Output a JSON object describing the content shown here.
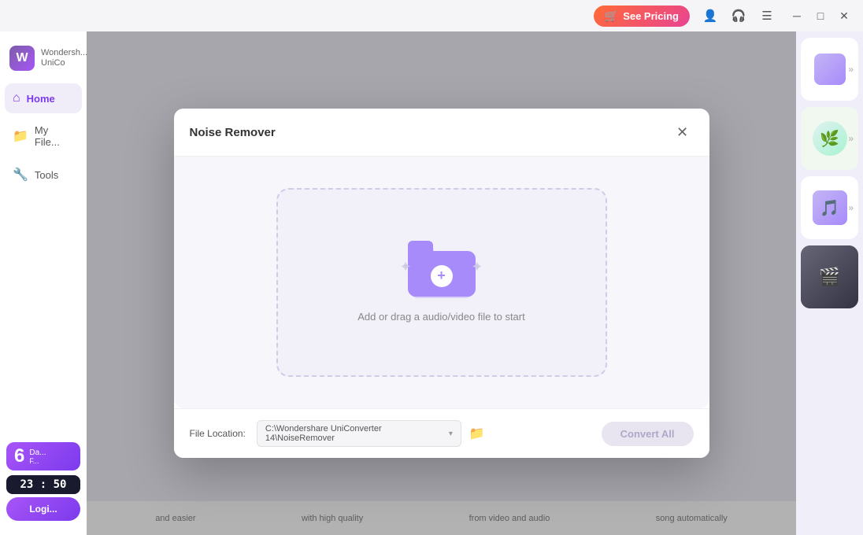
{
  "titlebar": {
    "see_pricing_label": "See Pricing",
    "cart_icon": "🛒",
    "user_icon": "👤",
    "headset_icon": "🎧",
    "menu_icon": "☰",
    "minimize_icon": "─",
    "maximize_icon": "□",
    "close_icon": "✕"
  },
  "sidebar": {
    "logo_text": "Wondersh...\nUniCo",
    "nav_items": [
      {
        "label": "Home",
        "icon": "⌂",
        "active": true
      },
      {
        "label": "My File...",
        "icon": "📁",
        "active": false
      },
      {
        "label": "Tools",
        "icon": "🔧",
        "active": false
      }
    ],
    "days_badge": {
      "number": "6",
      "label": "Da...",
      "sublabel": "F..."
    },
    "timer": "23 : 50",
    "login_label": "Logi..."
  },
  "modal": {
    "title": "Noise Remover",
    "close_icon": "✕",
    "drop_zone_text": "Add or drag a audio/video file to start",
    "folder_plus": "+",
    "sparkle_left": "✦",
    "sparkle_right": "✦",
    "footer": {
      "file_location_label": "File Location:",
      "file_path": "C:\\Wondershare UniConverter 14\\NoiseRemover",
      "chevron": "▾",
      "folder_icon": "📁",
      "convert_all_label": "Convert All"
    }
  },
  "right_panel": {
    "card1_more": "»",
    "card2_more": "»",
    "card3_more": "»"
  },
  "bottom_strip": {
    "items": [
      "and easier",
      "with high quality",
      "from video and audio",
      "song automatically"
    ]
  }
}
